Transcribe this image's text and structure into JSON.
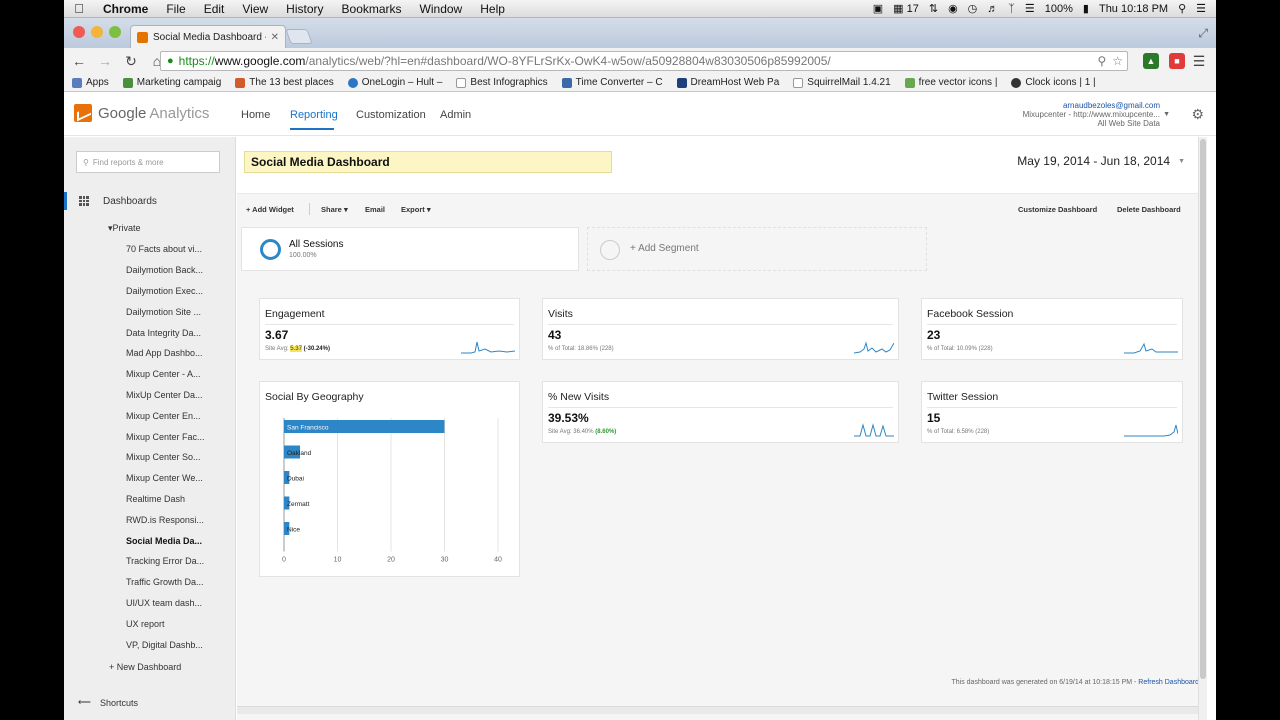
{
  "menubar": {
    "app": "Chrome",
    "items": [
      "File",
      "Edit",
      "View",
      "History",
      "Bookmarks",
      "Window",
      "Help"
    ],
    "status": {
      "calendar": "17",
      "battery": "100%",
      "clock": "Thu 10:18 PM"
    }
  },
  "browser": {
    "tab_title": "Social Media Dashboard - ",
    "url": {
      "scheme": "https://",
      "host": "www.google.com",
      "path": "/analytics/web/?hl=en#dashboard/WO-8YFLrSrKx-OwK4-w5ow/a50928804w83030506p85992005/"
    },
    "bookmarks": [
      {
        "label": "Apps",
        "color": "#5a7bbf"
      },
      {
        "label": "Marketing campaig",
        "color": "#4a8f3c"
      },
      {
        "label": "The 13 best places",
        "color": "#d25a2b"
      },
      {
        "label": "OneLogin – Hult –",
        "color": "#2b77c4"
      },
      {
        "label": "Best Infographics",
        "color": "#999999"
      },
      {
        "label": "Time Converter – C",
        "color": "#3a6aa8"
      },
      {
        "label": "DreamHost Web Pa",
        "color": "#1f3f7a"
      },
      {
        "label": "SquirrelMail 1.4.21",
        "color": "#aaaaaa"
      },
      {
        "label": "free vector icons |",
        "color": "#6aa84f"
      },
      {
        "label": "Clock icons | 1 |",
        "color": "#333333"
      }
    ]
  },
  "ga": {
    "logo_text": {
      "brand": "Google",
      "product": "Analytics"
    },
    "nav": [
      "Home",
      "Reporting",
      "Customization",
      "Admin"
    ],
    "account": {
      "email": "arnaudbezoles@gmail.com",
      "property": "Mixupcenter - http://www.mixupcente...",
      "view": "All Web Site Data"
    }
  },
  "sidebar": {
    "search_placeholder": "Find reports & more",
    "section": "Dashboards",
    "group": "Private",
    "items": [
      "70 Facts about vi...",
      "Dailymotion Back...",
      "Dailymotion Exec...",
      "Dailymotion Site ...",
      "Data Integrity Da...",
      "Mad App Dashbo...",
      "Mixup Center - A...",
      "MixUp Center Da...",
      "Mixup Center En...",
      "Mixup Center Fac...",
      "Mixup Center So...",
      "Mixup Center We...",
      "Realtime Dash",
      "RWD.is Responsi...",
      "Social Media Da...",
      "Tracking Error Da...",
      "Traffic Growth Da...",
      "UI/UX team dash...",
      "UX report",
      "VP, Digital Dashb..."
    ],
    "selected_index": 14,
    "new_dashboard": "+ New Dashboard",
    "shortcuts": "Shortcuts"
  },
  "dashboard": {
    "title": "Social Media Dashboard",
    "date_range": "May 19, 2014 - Jun 18, 2014",
    "actions": {
      "add_widget": "+ Add Widget",
      "share": "Share",
      "email": "Email",
      "export": "Export",
      "customize": "Customize Dashboard",
      "delete": "Delete Dashboard"
    },
    "segments": {
      "all_sessions": "All Sessions",
      "all_sessions_pct": "100.00%",
      "add_segment": "+ Add Segment"
    },
    "widgets": {
      "engagement": {
        "title": "Engagement",
        "value": "3.67",
        "sub_prefix": "Site Avg:",
        "sub_highlight": "5.37",
        "sub_change": "(-30.24%)"
      },
      "visits": {
        "title": "Visits",
        "value": "43",
        "sub": "% of Total: 18.86% (228)"
      },
      "facebook": {
        "title": "Facebook Session",
        "value": "23",
        "sub": "% of Total: 10.09% (228)"
      },
      "new_visits": {
        "title": "% New Visits",
        "value": "39.53%",
        "sub_prefix": "Site Avg: 36.40%",
        "sub_change": "(8.60%)"
      },
      "twitter": {
        "title": "Twitter Session",
        "value": "15",
        "sub": "% of Total: 6.58% (228)"
      },
      "geography": {
        "title": "Social By Geography"
      }
    },
    "footer": {
      "generated": "This dashboard was generated on 6/19/14 at 10:18:15 PM -",
      "refresh": "Refresh Dashboard"
    }
  },
  "chart_data": {
    "type": "bar",
    "orientation": "horizontal",
    "categories": [
      "San Francisco",
      "Oakland",
      "Dubai",
      "Zermatt",
      "Nice"
    ],
    "values": [
      30,
      3,
      1,
      1,
      1
    ],
    "xlim": [
      0,
      40
    ],
    "xticks": [
      0,
      10,
      20,
      30,
      40
    ],
    "bar_color": "#2d86c5",
    "grid": true
  }
}
